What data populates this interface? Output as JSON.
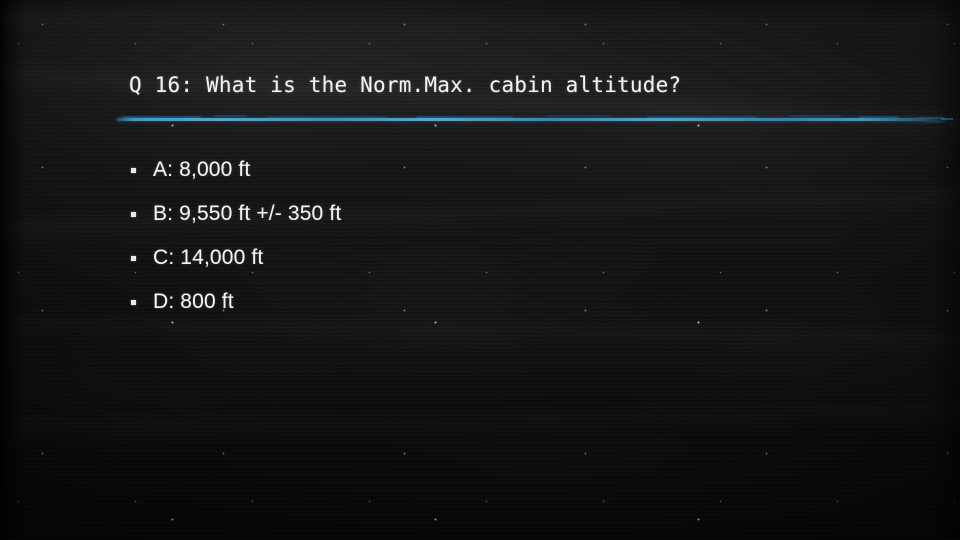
{
  "slide": {
    "question_number": "Q 16",
    "title": "Q 16: What is the Norm.Max. cabin altitude?",
    "divider_color": "#46aadc",
    "text_color": "#f4f5f6",
    "background_color": "#121213",
    "answers": [
      {
        "label": "A",
        "text": "A: 8,000 ft",
        "bullet": "square-bullet-icon"
      },
      {
        "label": "B",
        "text": "B: 9,550 ft +/- 350 ft",
        "bullet": "square-bullet-icon"
      },
      {
        "label": "C",
        "text": "C: 14,000 ft",
        "bullet": "square-bullet-icon"
      },
      {
        "label": "D",
        "text": "D: 800 ft",
        "bullet": "square-bullet-icon"
      }
    ]
  }
}
